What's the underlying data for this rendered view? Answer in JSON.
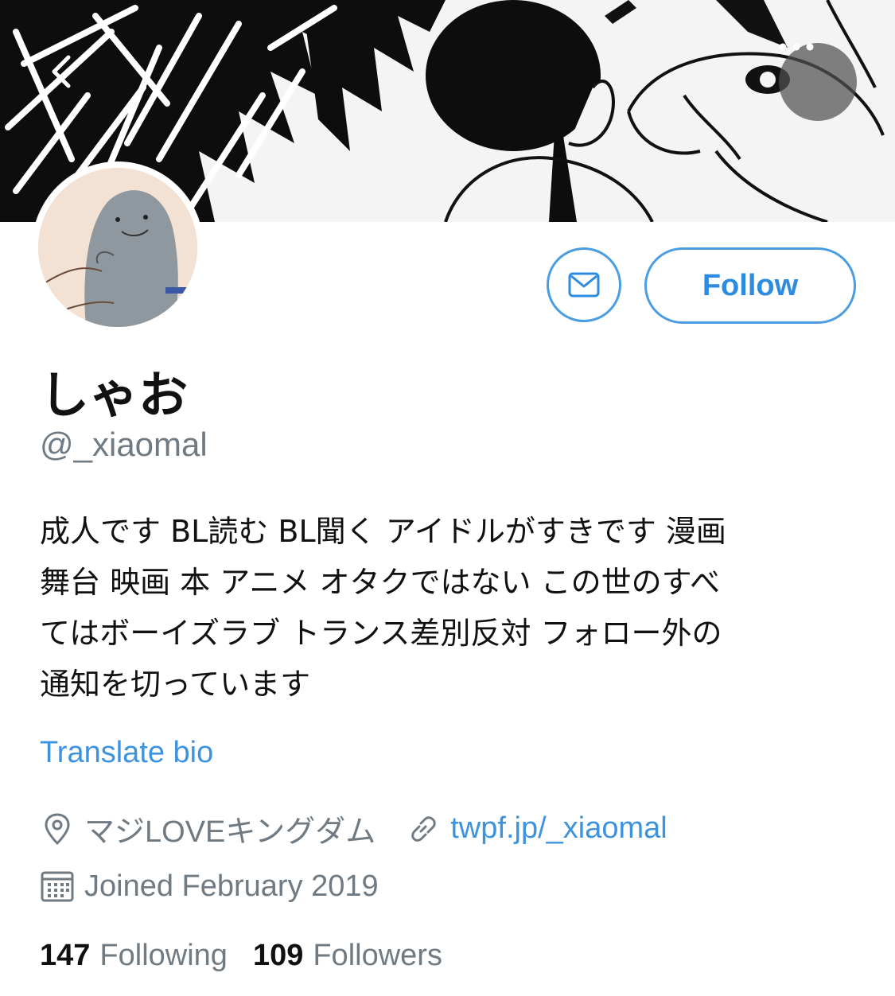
{
  "header": {
    "back_icon": "chevron-left-icon",
    "more_icon": "more-dots-icon"
  },
  "profile": {
    "display_name": "しゃお",
    "handle": "@_xiaomal",
    "follow_label": "Follow",
    "dm_icon": "mail-icon",
    "bio_lines": [
      "成人です BL読む BL聞く アイドルがすきです 漫画",
      "舞台 映画 本 アニメ オタクではない この世のすべ",
      "てはボーイズラブ トランス差別反対 フォロー外の",
      "通知を切っています"
    ],
    "translate_label": "Translate bio",
    "location": "マジLOVEキングダム",
    "website": "twpf.jp/_xiaomal",
    "joined": "Joined February 2019",
    "following_count": "147",
    "following_label": "Following",
    "followers_count": "109",
    "followers_label": "Followers"
  },
  "colors": {
    "accent": "#4a9de3",
    "secondary_text": "#6f7a83",
    "primary_text": "#111111"
  }
}
